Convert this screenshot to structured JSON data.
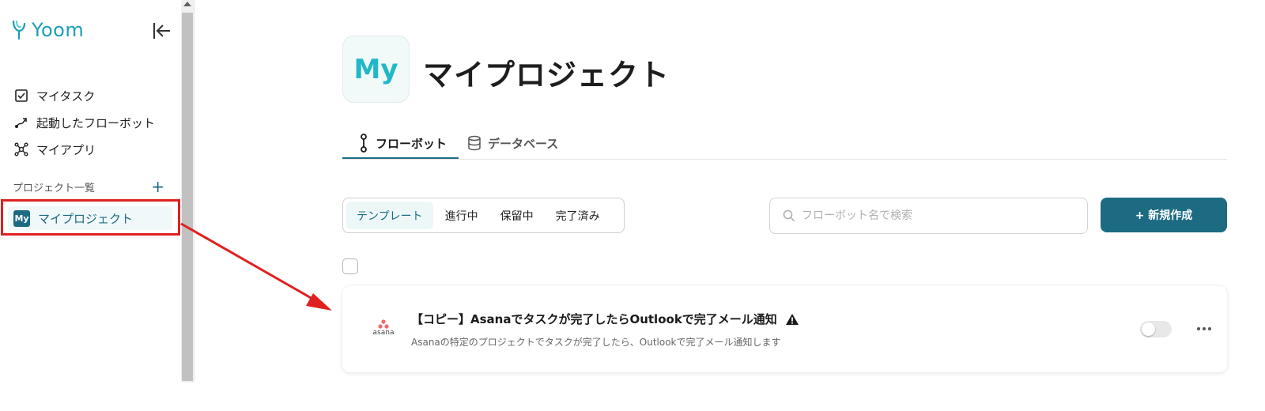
{
  "sidebar": {
    "logo_text": "Yoom",
    "nav": [
      {
        "label": "マイタスク",
        "icon": "checkbox-icon"
      },
      {
        "label": "起動したフローボット",
        "icon": "flow-arrow-icon"
      },
      {
        "label": "マイアプリ",
        "icon": "apps-hub-icon"
      }
    ],
    "projects_heading": "プロジェクト一覧",
    "add_symbol": "+",
    "projects": [
      {
        "badge": "My",
        "label": "マイプロジェクト"
      }
    ]
  },
  "project": {
    "avatar": "My",
    "title": "マイプロジェクト"
  },
  "tabs": [
    {
      "label": "フローボット",
      "active": true,
      "icon": "flowbot-icon"
    },
    {
      "label": "データベース",
      "active": false,
      "icon": "database-icon"
    }
  ],
  "filters": [
    {
      "label": "テンプレート",
      "active": true
    },
    {
      "label": "進行中",
      "active": false
    },
    {
      "label": "保留中",
      "active": false
    },
    {
      "label": "完了済み",
      "active": false
    }
  ],
  "search": {
    "placeholder": "フローボット名で検索"
  },
  "new_button": "+ 新規作成",
  "flows": [
    {
      "app": "asana",
      "title": "【コピー】Asanaでタスクが完了したらOutlookで完了メール通知",
      "description": "Asanaの特定のプロジェクトでタスクが完了したら、Outlookで完了メール通知します",
      "warning": true,
      "enabled": false
    }
  ],
  "colors": {
    "brand": "#1c6b83",
    "logo": "#1a9fb8",
    "annotation": "#e02020"
  }
}
